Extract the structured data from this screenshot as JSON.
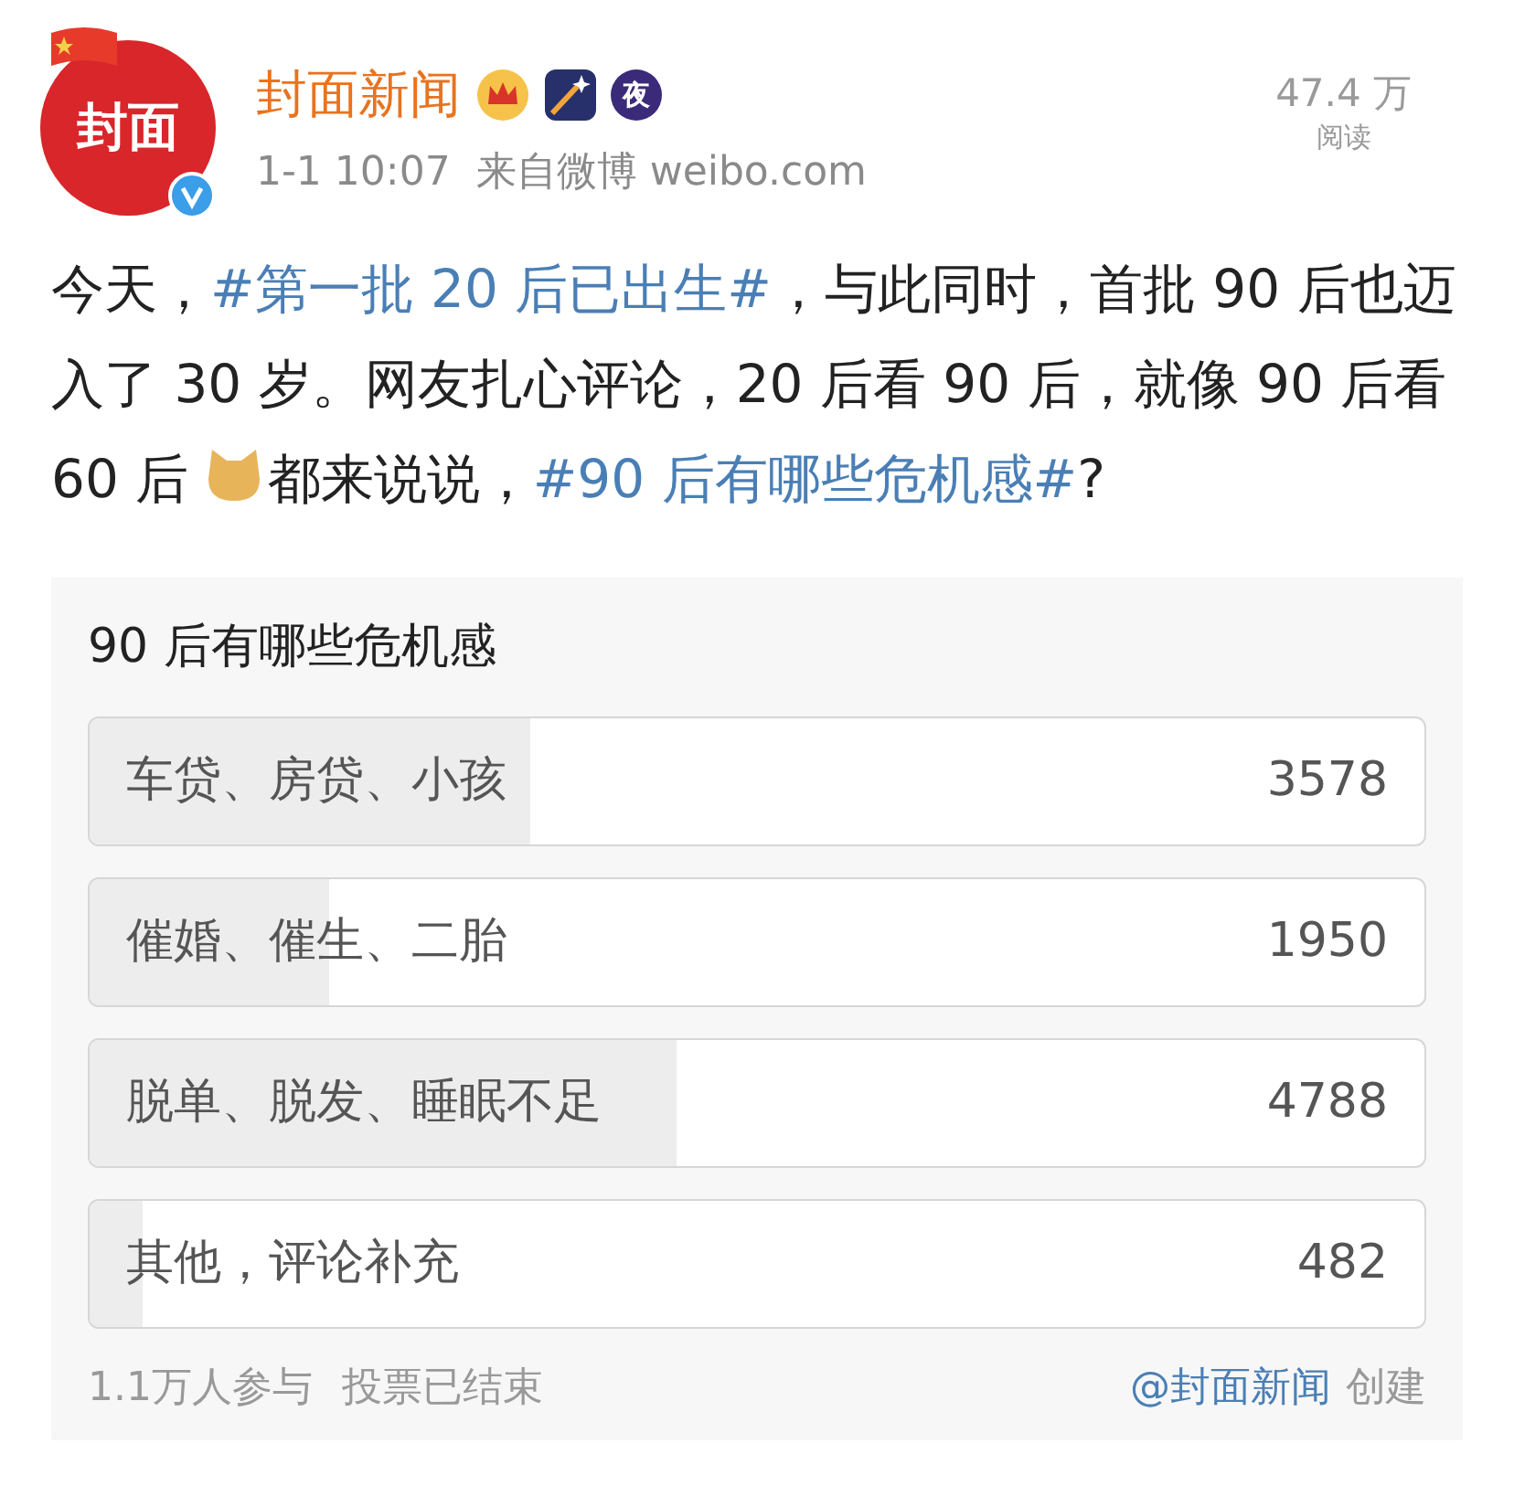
{
  "author": {
    "avatar_text": "封面",
    "name": "封面新闻",
    "verified": true,
    "time": "1-1 10:07",
    "source": "来自微博 weibo.com",
    "badges": [
      {
        "kind": "crown"
      },
      {
        "kind": "star"
      },
      {
        "kind": "night",
        "text": "夜"
      }
    ]
  },
  "reads": {
    "count": "47.4 万",
    "label": "阅读"
  },
  "post": [
    {
      "kind": "text",
      "text": "今天，"
    },
    {
      "kind": "hashtag",
      "text": "#第一批 20 后已出生#"
    },
    {
      "kind": "text",
      "text": "，与此同时，首批 90 后也迈入了 30 岁。网友扎心评论，20 后看 90 后，就像 90 后看 60 后 "
    },
    {
      "kind": "emoji"
    },
    {
      "kind": "text",
      "text": "都来说说，"
    },
    {
      "kind": "hashtag",
      "text": "#90 后有哪些危机感#"
    },
    {
      "kind": "text",
      "text": "?"
    }
  ],
  "poll": {
    "title": "90 后有哪些危机感",
    "options": [
      {
        "label": "车贷、房贷、小孩",
        "count": "3578",
        "level": 0.33
      },
      {
        "label": "催婚、催生、二胎",
        "count": "1950",
        "level": 0.18
      },
      {
        "label": "脱单、脱发、睡眠不足",
        "count": "4788",
        "level": 0.44
      },
      {
        "label": "其他，评论补充",
        "count": "482",
        "level": 0.04
      }
    ],
    "participants": "1.1万人参与",
    "status": "投票已结束",
    "creator": "@封面新闻",
    "created_label": "创建"
  }
}
